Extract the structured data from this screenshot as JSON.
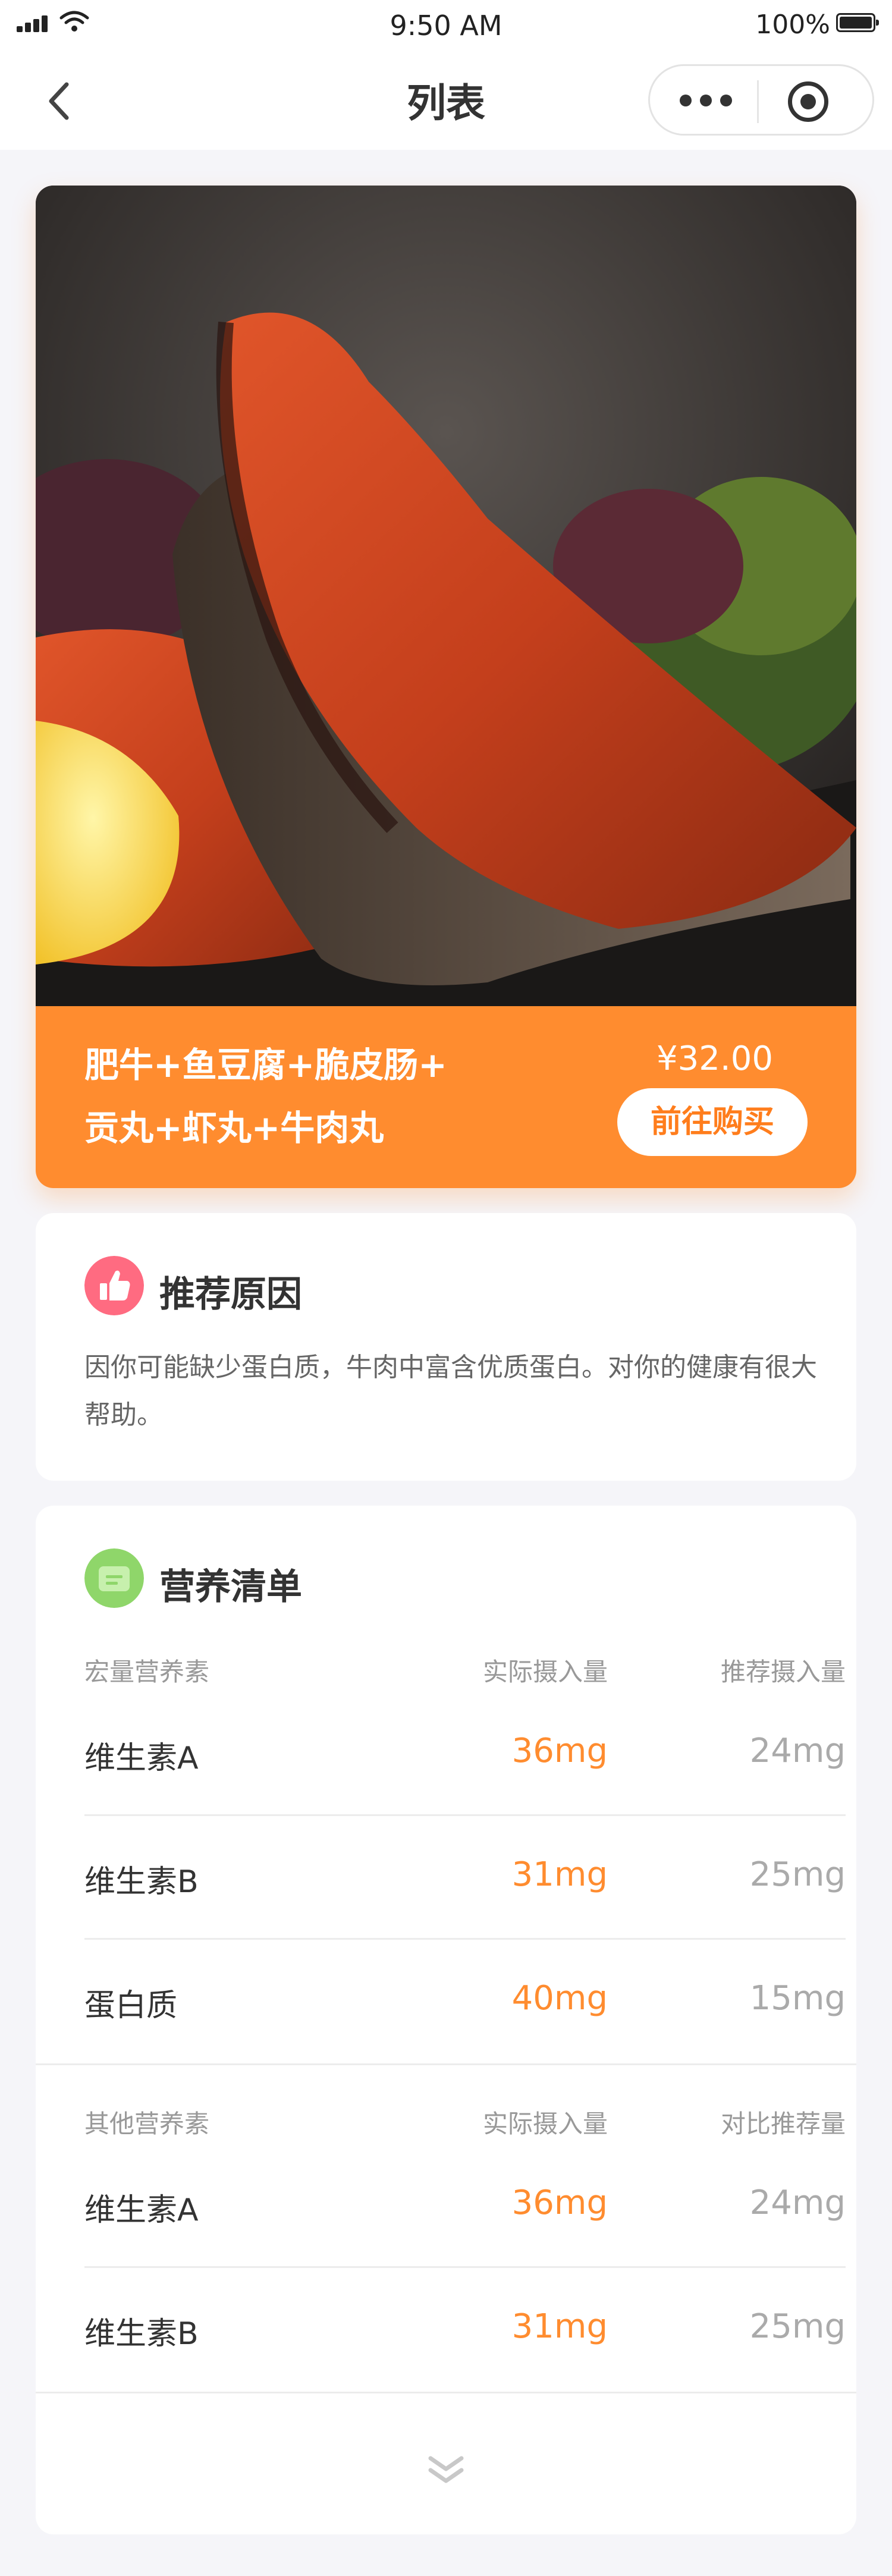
{
  "status": {
    "time": "9:50 AM",
    "battery": "100%"
  },
  "nav": {
    "title": "列表"
  },
  "product": {
    "name_line1": "肥牛+鱼豆腐+脆皮肠+",
    "name_line2": "贡丸+虾丸+牛肉丸",
    "price": "¥32.00",
    "buy_label": "前往购买"
  },
  "reason": {
    "title": "推荐原因",
    "text": "因你可能缺少蛋白质，牛肉中富含优质蛋白。对你的健康有很大帮助。"
  },
  "nutrition": {
    "title": "营养清单",
    "macro": {
      "headers": [
        "宏量营养素",
        "实际摄入量",
        "推荐摄入量"
      ],
      "rows": [
        {
          "name": "维生素A",
          "actual": "36mg",
          "recommended": "24mg"
        },
        {
          "name": "维生素B",
          "actual": "31mg",
          "recommended": "25mg"
        },
        {
          "name": "蛋白质",
          "actual": "40mg",
          "recommended": "15mg"
        }
      ]
    },
    "other": {
      "headers": [
        "其他营养素",
        "实际摄入量",
        "对比推荐量"
      ],
      "rows": [
        {
          "name": "维生素A",
          "actual": "36mg",
          "recommended": "24mg"
        },
        {
          "name": "维生素B",
          "actual": "31mg",
          "recommended": "25mg"
        }
      ]
    }
  },
  "colors": {
    "accent": "#ff8c2f",
    "thumb_badge": "#ff6b81",
    "list_badge": "#8fd66a"
  }
}
